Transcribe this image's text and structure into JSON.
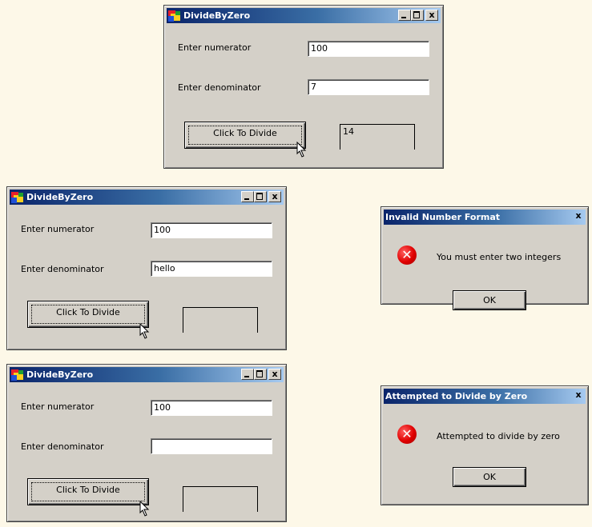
{
  "app": {
    "title": "DivideByZero",
    "minimize_glyph": "_",
    "maximize_glyph": "",
    "close_glyph": "x",
    "numerator_label": "Enter numerator",
    "denominator_label": "Enter denominator",
    "divide_button_label": "Click To Divide"
  },
  "windows": [
    {
      "numerator_value": "100",
      "denominator_value": "7",
      "result_value": "14"
    },
    {
      "numerator_value": "100",
      "denominator_value": "hello",
      "result_value": ""
    },
    {
      "numerator_value": "100",
      "denominator_value": "",
      "result_value": ""
    }
  ],
  "dialogs": [
    {
      "title": "Invalid Number Format",
      "message": "You must enter two integers",
      "ok_label": "OK",
      "close_glyph": "x",
      "icon": "error-icon"
    },
    {
      "title": "Attempted to Divide by Zero",
      "message": "Attempted to divide by zero",
      "ok_label": "OK",
      "close_glyph": "x",
      "icon": "error-icon"
    }
  ],
  "colors": {
    "desktop": "#FDF8E8",
    "window_face": "#D4D0C8",
    "titlebar_active": "#0A246A",
    "error_icon": "#E00000"
  }
}
